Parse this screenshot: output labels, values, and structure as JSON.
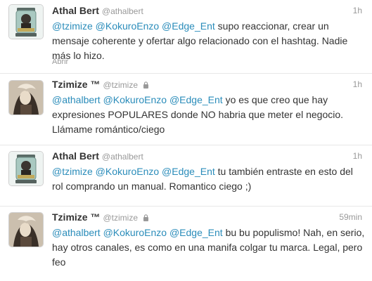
{
  "tweets": [
    {
      "name": "Athal Bert",
      "handle": "@athalbert",
      "time": "1h",
      "locked": false,
      "mentions": [
        "@tzimize",
        "@KokuroEnzo",
        "@Edge_Ent"
      ],
      "text": "supo reaccionar, crear un mensaje coherente y ofertar algo relacionado con el hashtag. Nadie más lo hizo.",
      "action": "Abrir"
    },
    {
      "name": "Tzimize ™",
      "handle": "@tzimize",
      "time": "1h",
      "locked": true,
      "mentions": [
        "@athalbert",
        "@KokuroEnzo",
        "@Edge_Ent"
      ],
      "text": "yo es que creo que hay expresiones POPULARES donde NO habria que meter el negocio. Llámame romántico/ciego",
      "action": ""
    },
    {
      "name": "Athal Bert",
      "handle": "@athalbert",
      "time": "1h",
      "locked": false,
      "mentions": [
        "@tzimize",
        "@KokuroEnzo",
        "@Edge_Ent"
      ],
      "text": "tu también entraste en esto del rol comprando un manual. Romantico ciego ;)",
      "action": ""
    },
    {
      "name": "Tzimize ™",
      "handle": "@tzimize",
      "time": "59min",
      "locked": true,
      "mentions": [
        "@athalbert",
        "@KokuroEnzo",
        "@Edge_Ent"
      ],
      "text": "bu bu populismo! Nah, en serio, hay otros canales, es como en una manifa colgar tu marca. Legal, pero feo",
      "action": ""
    }
  ],
  "colors": {
    "mention": "#2a8cba",
    "text": "#333333",
    "muted": "#999999",
    "thread_line": "#d6e3ec"
  },
  "icons": {
    "lock": "lock-icon",
    "avatar_athal": "jar-portrait-avatar",
    "avatar_tzimize": "painted-portrait-avatar"
  }
}
